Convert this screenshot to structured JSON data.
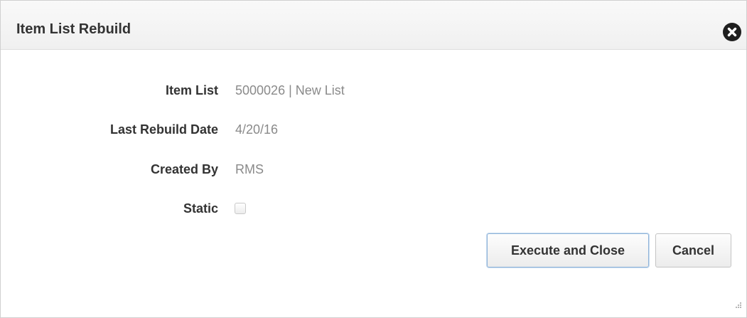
{
  "dialog": {
    "title": "Item List Rebuild",
    "close_icon": "close-circle-icon"
  },
  "fields": {
    "item_list": {
      "label": "Item List",
      "value": "5000026 | New List"
    },
    "last_rebuild_date": {
      "label": "Last Rebuild Date",
      "value": "4/20/16"
    },
    "created_by": {
      "label": "Created By",
      "value": "RMS"
    },
    "static": {
      "label": "Static",
      "checked": false
    }
  },
  "buttons": {
    "execute_label": "Execute and Close",
    "cancel_label": "Cancel"
  },
  "colors": {
    "label_text": "#333333",
    "value_text": "#8a8a8a",
    "focus_border": "#8fb3d9"
  }
}
